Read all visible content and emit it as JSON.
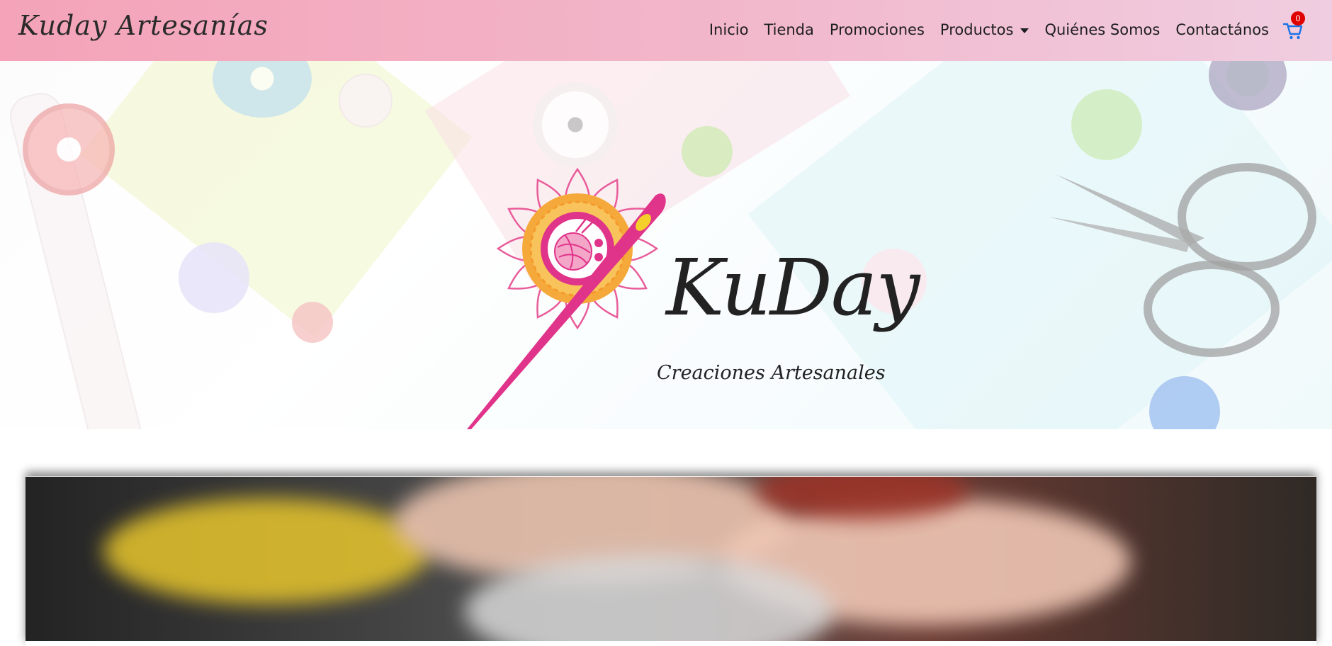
{
  "navbar": {
    "brand": "Kuday Artesanías",
    "items": [
      {
        "label": "Inicio"
      },
      {
        "label": "Tienda"
      },
      {
        "label": "Promociones"
      },
      {
        "label": "Productos",
        "has_dropdown": true
      },
      {
        "label": "Quiénes Somos"
      },
      {
        "label": "Contactános"
      }
    ],
    "cart": {
      "icon": "cart-icon",
      "count": "0"
    },
    "colors": {
      "gradient_start": "#f4a3b8",
      "gradient_end": "#f0cde0",
      "badge": "#e00000",
      "cart_icon": "#1a73e8"
    }
  },
  "hero": {
    "logo_title": "KuDay",
    "logo_subtitle": "Creaciones Artesanales",
    "icons": [
      "needle-icon",
      "mandala-icon",
      "yarn-ball-icon",
      "scissors-icon",
      "button-icon",
      "measuring-tape-icon",
      "thread-spool-icon"
    ],
    "colors": {
      "pink": "#e0338a",
      "orange": "#f6a93b",
      "yellow": "#f5d02a"
    }
  },
  "feature_image": {
    "description_icon": "sewing-hands-photo"
  }
}
